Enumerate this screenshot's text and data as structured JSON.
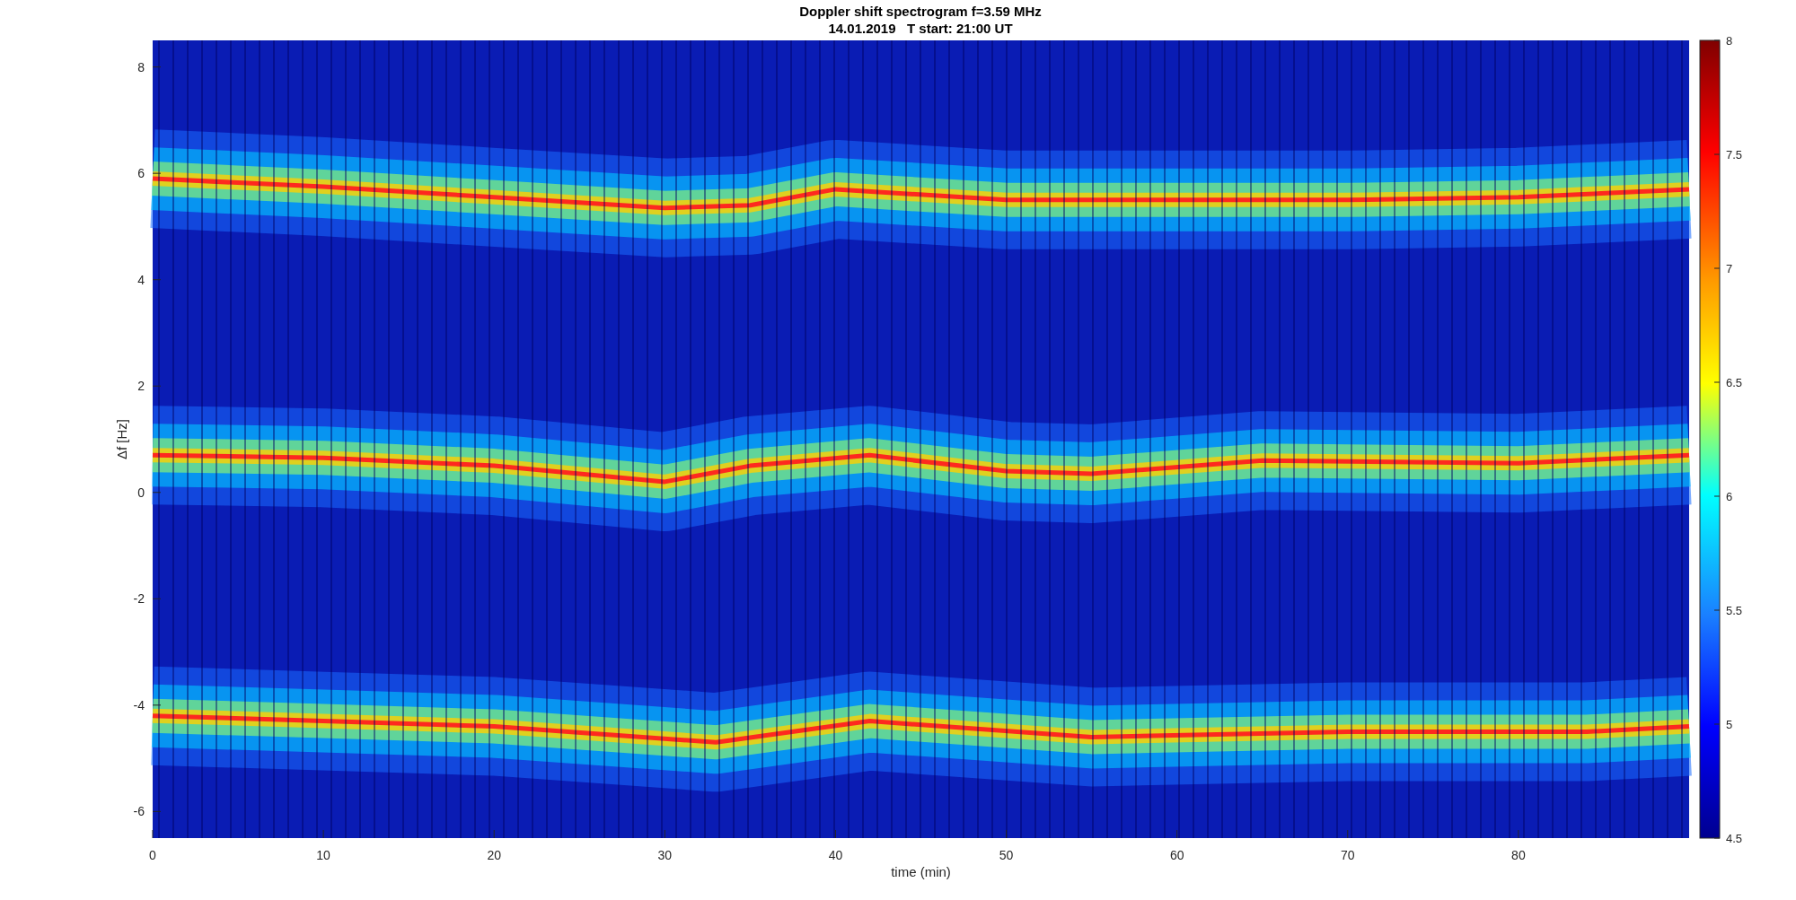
{
  "figure": {
    "title": "Doppler shift spectrogram f=3.59 MHz",
    "subtitle": "14.01.2019   T start: 21:00 UT"
  },
  "axes": {
    "xlabel": "time (min)",
    "ylabel": "Δf [Hz]",
    "xticks": [
      "0",
      "10",
      "20",
      "30",
      "40",
      "50",
      "60",
      "70",
      "80"
    ],
    "yticks": [
      "8",
      "6",
      "4",
      "2",
      "0",
      "-2",
      "-4",
      "-6"
    ]
  },
  "colorbar": {
    "ticks": [
      "8",
      "7.5",
      "7",
      "6.5",
      "6",
      "5.5",
      "5",
      "4.5"
    ]
  }
}
